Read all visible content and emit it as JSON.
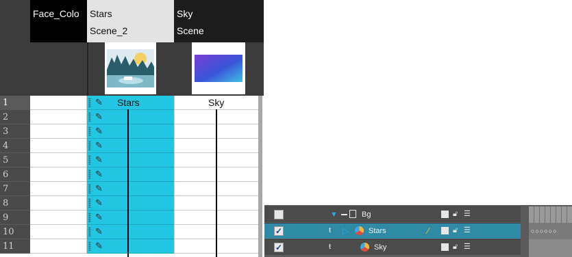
{
  "xsheet": {
    "columns": [
      {
        "name": "Face_Colo",
        "scene": ""
      },
      {
        "name": "Stars",
        "scene": "Scene_2"
      },
      {
        "name": "Sky",
        "scene": "Scene"
      }
    ],
    "rows": [
      "1",
      "2",
      "3",
      "4",
      "5",
      "6",
      "7",
      "8",
      "9",
      "10",
      "11"
    ],
    "first_row_labels": {
      "stars": "Stars",
      "sky": "Sky"
    },
    "colors": {
      "stars_cell": "#23c6e2",
      "header_dark": "#3b3b3b"
    }
  },
  "timeline": {
    "layers": [
      {
        "label": "Bg",
        "checked": false,
        "icon": "group-icon"
      },
      {
        "label": "Stars",
        "checked": true,
        "icon": "drawing-layer-icon"
      },
      {
        "label": "Sky",
        "checked": true,
        "icon": "drawing-layer-icon"
      }
    ],
    "check_glyph": "✓"
  },
  "right_panel": {
    "dots": "○○○○○○"
  }
}
